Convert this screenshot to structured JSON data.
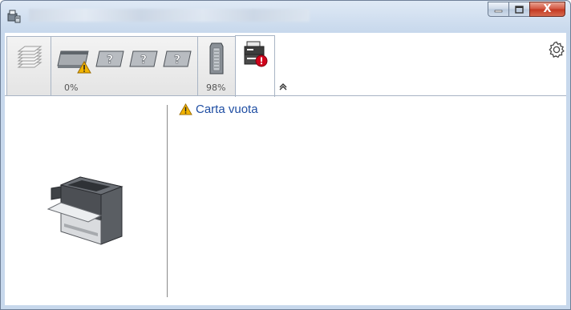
{
  "window": {
    "controls": {
      "minimize_icon": "minimize-icon",
      "maximize_icon": "maximize-icon",
      "close_label": "X"
    }
  },
  "toolbar": {
    "paper_tab": {
      "icon": "paper-stack-icon"
    },
    "toner_tab": {
      "level": "0%",
      "warning_icon": "warning-icon",
      "unknown_icon": "unknown-cartridge-icon"
    },
    "waste_tab": {
      "level": "98%"
    },
    "device_tab": {
      "icon": "device-error-icon"
    },
    "collapse_icon": "chevron-up-icon",
    "settings_icon": "gear-icon"
  },
  "status": {
    "message": "Carta vuota",
    "icon": "warning-icon",
    "color": "#1f4ea3"
  },
  "colors": {
    "warning": "#f2b400",
    "error": "#d0021b"
  }
}
